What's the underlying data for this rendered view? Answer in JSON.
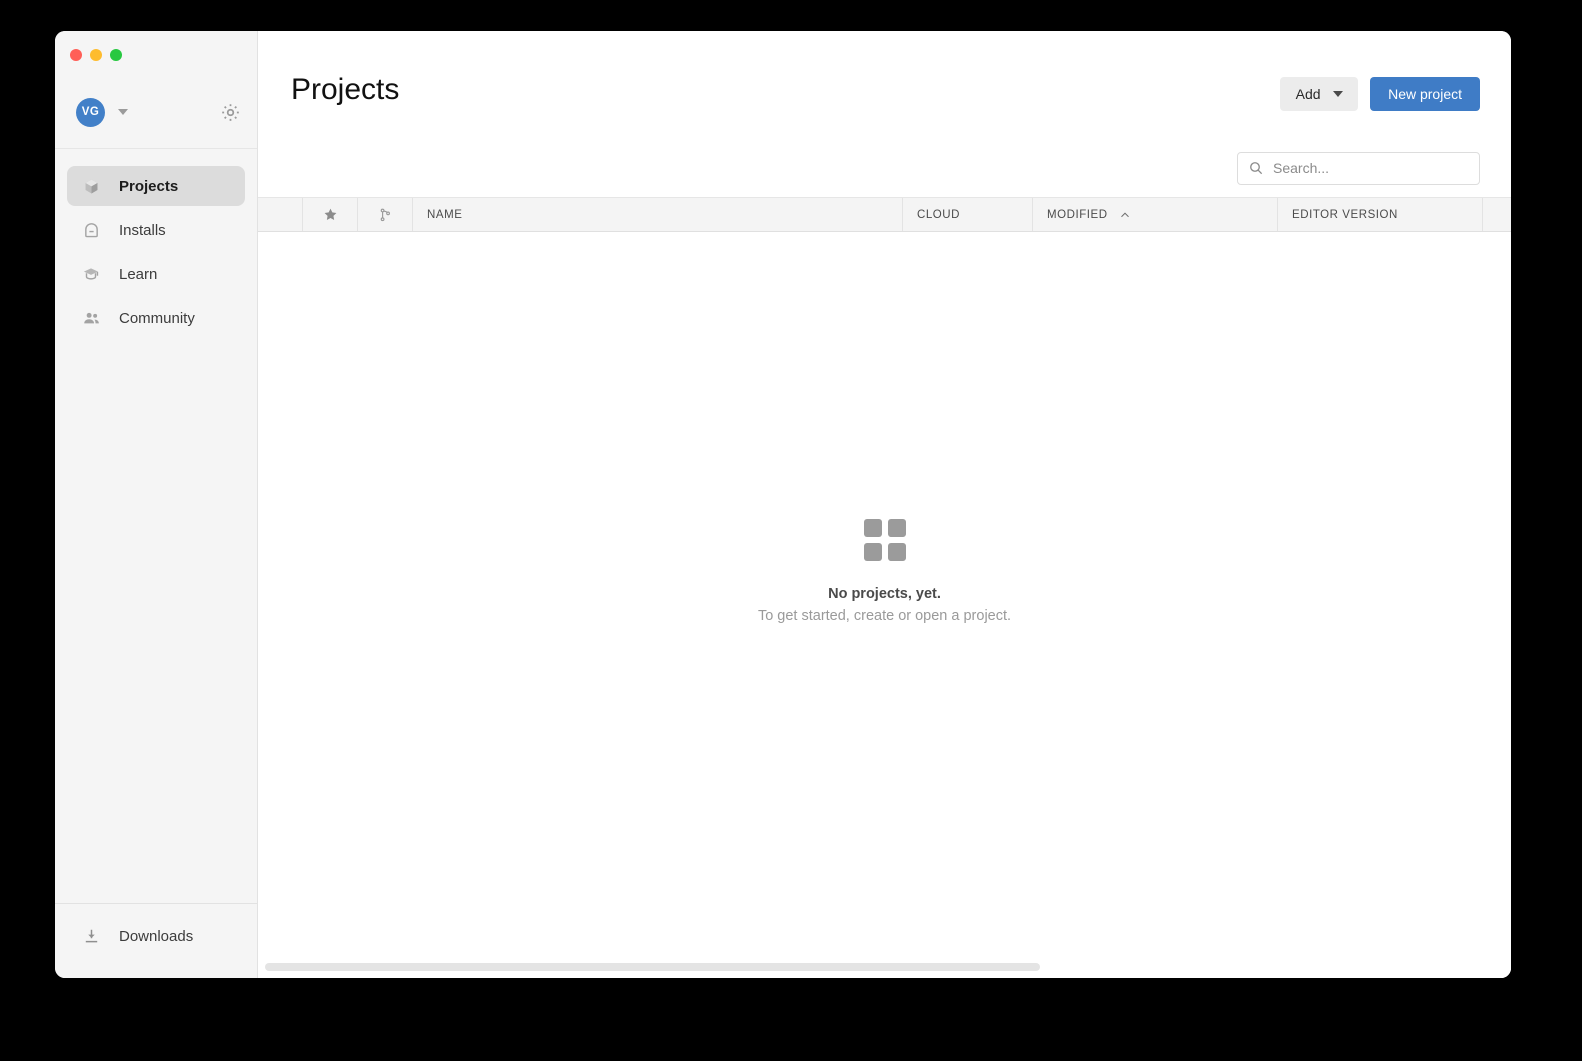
{
  "window": {
    "traffic_lights": [
      {
        "name": "close",
        "color": "#ff5f57"
      },
      {
        "name": "minimize",
        "color": "#febc2e"
      },
      {
        "name": "zoom",
        "color": "#28c840"
      }
    ]
  },
  "sidebar": {
    "account": {
      "avatar_initials": "VG",
      "avatar_color": "#4280c8",
      "caret_icon": "chevron-down-icon",
      "settings_icon": "gear-icon"
    },
    "items": [
      {
        "label": "Projects",
        "icon": "cube-icon",
        "active": true
      },
      {
        "label": "Installs",
        "icon": "archive-icon",
        "active": false
      },
      {
        "label": "Learn",
        "icon": "graduation-cap-icon",
        "active": false
      },
      {
        "label": "Community",
        "icon": "people-icon",
        "active": false
      }
    ],
    "footer": {
      "label": "Downloads",
      "icon": "download-icon"
    }
  },
  "header": {
    "title": "Projects",
    "add_label": "Add",
    "add_caret_icon": "caret-down-icon",
    "new_project_label": "New project",
    "new_project_color": "#3f7cc6"
  },
  "search": {
    "placeholder": "Search...",
    "value": "",
    "icon": "search-icon"
  },
  "table": {
    "columns": [
      {
        "key": "spacer",
        "label": "",
        "icon": null
      },
      {
        "key": "favorite",
        "label": "",
        "icon": "star-icon"
      },
      {
        "key": "vcs",
        "label": "",
        "icon": "git-branch-icon"
      },
      {
        "key": "name",
        "label": "NAME",
        "icon": null
      },
      {
        "key": "cloud",
        "label": "CLOUD",
        "icon": null
      },
      {
        "key": "modified",
        "label": "MODIFIED",
        "icon": "sort-ascending-icon",
        "sorted": "asc"
      },
      {
        "key": "editor",
        "label": "EDITOR VERSION",
        "icon": null
      }
    ],
    "rows": []
  },
  "empty_state": {
    "icon": "grid-2x2-icon",
    "title": "No projects, yet.",
    "subtitle": "To get started, create or open a project."
  },
  "scrollbar": {
    "orientation": "horizontal",
    "thumb_color": "#e4e4e4"
  }
}
